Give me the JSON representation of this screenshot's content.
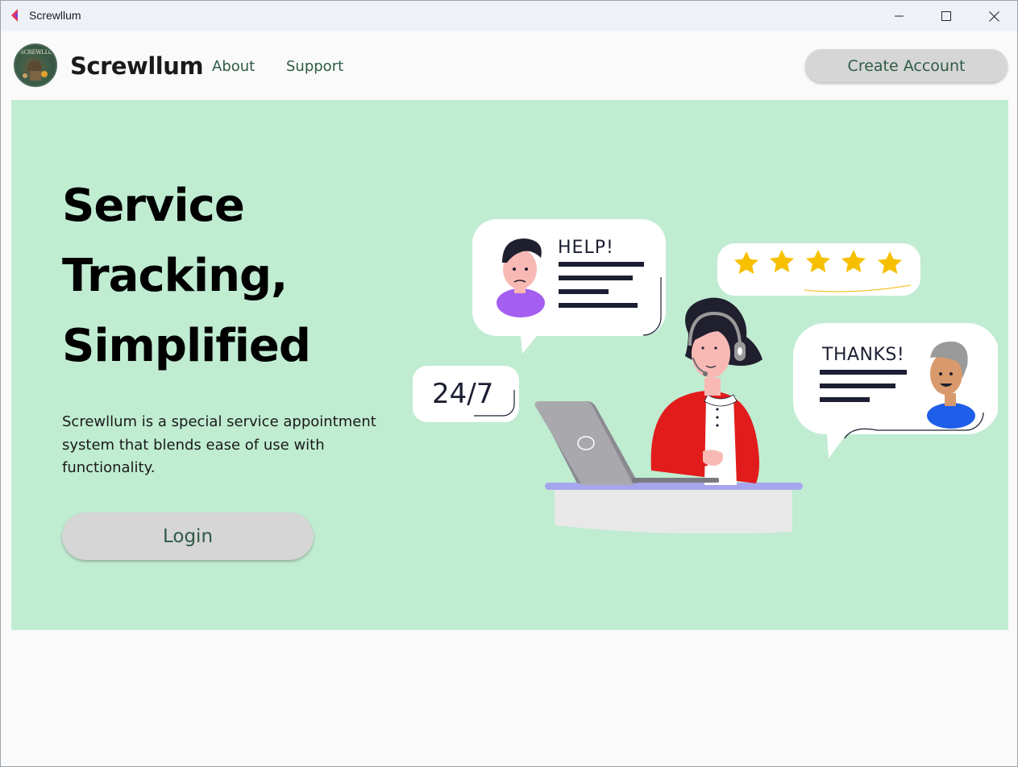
{
  "window": {
    "title": "Screwllum",
    "controls": {
      "minimize": "minimize-icon",
      "maximize": "maximize-icon",
      "close": "close-icon"
    }
  },
  "navbar": {
    "brand": "Screwllum",
    "logo_text": "SCREWLLUM",
    "links": [
      "About",
      "Support"
    ],
    "create_account": "Create Account"
  },
  "hero": {
    "title_lines": [
      "Service",
      "Tracking,",
      "Simplified"
    ],
    "description": "Screwllum is a special service appointment system that blends ease of use with functionality.",
    "login": "Login"
  },
  "illustration": {
    "help_text": "HELP!",
    "thanks_text": "THANKS!",
    "availability": "24/7",
    "rating_stars": 5
  },
  "colors": {
    "hero_bg": "#c0ecd2",
    "accent_text": "#2e5a45",
    "button_bg": "#d6d6d6",
    "titlebar_bg": "#eef2f8"
  }
}
